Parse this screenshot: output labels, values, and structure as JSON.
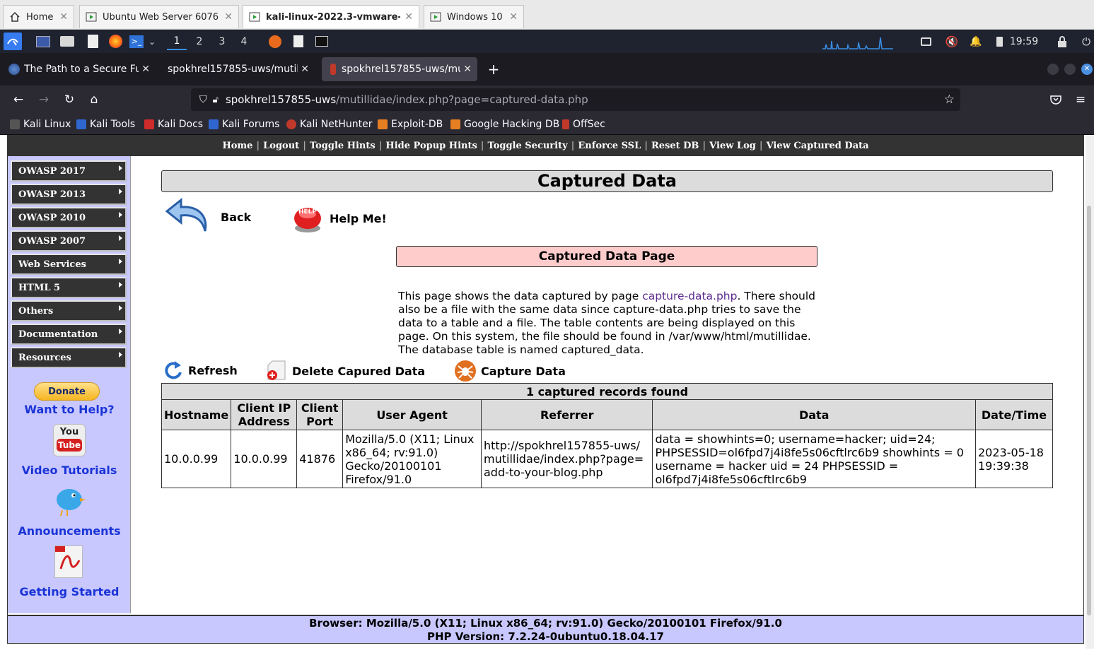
{
  "vm_tabs": [
    {
      "label": "Home",
      "active": false
    },
    {
      "label": "Ubuntu Web Server 6076",
      "active": false
    },
    {
      "label": "kali-linux-2022.3-vmware-a...",
      "active": true
    },
    {
      "label": "Windows 10",
      "active": false
    }
  ],
  "taskbar": {
    "workspaces": [
      "1",
      "2",
      "3",
      "4"
    ],
    "clock": "19:59"
  },
  "firefox_tabs": [
    {
      "label": "The Path to a Secure Futu",
      "active": false
    },
    {
      "label": "spokhrel157855-uws/mutillic",
      "active": false
    },
    {
      "label": "spokhrel157855-uws/mut",
      "active": true
    }
  ],
  "url": {
    "host": "spokhrel157855-uws",
    "path": "/mutillidae/index.php?page=captured-data.php"
  },
  "bookmarks": [
    {
      "label": "Kali Linux",
      "color": "#2b2a33"
    },
    {
      "label": "Kali Tools",
      "color": "#2f66d0"
    },
    {
      "label": "Kali Docs",
      "color": "#d02b2b"
    },
    {
      "label": "Kali Forums",
      "color": "#2f66d0"
    },
    {
      "label": "Kali NetHunter",
      "color": "#c0392b"
    },
    {
      "label": "Exploit-DB",
      "color": "#e67e22"
    },
    {
      "label": "Google Hacking DB",
      "color": "#e67e22"
    },
    {
      "label": "OffSec",
      "color": "#c0392b"
    }
  ],
  "top_menu": [
    "Home",
    "Logout",
    "Toggle Hints",
    "Hide Popup Hints",
    "Toggle Security",
    "Enforce SSL",
    "Reset DB",
    "View Log",
    "View Captured Data"
  ],
  "side_menu": [
    "OWASP 2017",
    "OWASP 2013",
    "OWASP 2010",
    "OWASP 2007",
    "Web Services",
    "HTML 5",
    "Others",
    "Documentation",
    "Resources"
  ],
  "side_links": {
    "donate": "Donate",
    "help": "Want to Help?",
    "youtube_line1": "You",
    "youtube_line2": "Tube",
    "video": "Video Tutorials",
    "announcements": "Announcements",
    "getting_started": "Getting Started"
  },
  "page": {
    "title": "Captured Data",
    "back": "Back",
    "help": "Help Me!",
    "help_icon_text": "HELP",
    "subtitle": "Captured Data Page",
    "desc_before": "This page shows the data captured by page ",
    "desc_link": "capture-data.php",
    "desc_after": ". There should also be a file with the same data since capture-data.php tries to save the data to a table and a file. The table contents are being displayed on this page. On this system, the file should be found in /var/www/html/mutillidae. The database table is named captured_data.",
    "refresh": "Refresh",
    "delete": "Delete Capured Data",
    "capture": "Capture Data"
  },
  "table": {
    "caption": "1 captured records found",
    "headers": [
      "Hostname",
      "Client IP Address",
      "Client Port",
      "User Agent",
      "Referrer",
      "Data",
      "Date/Time"
    ],
    "rows": [
      [
        "10.0.0.99",
        "10.0.0.99",
        "41876",
        "Mozilla/5.0 (X11; Linux x86_64; rv:91.0) Gecko/20100101 Firefox/91.0",
        "http://spokhrel157855-uws/mutillidae/index.php?page=add-to-your-blog.php",
        "data = showhints=0; username=hacker; uid=24; PHPSESSID=ol6fpd7j4i8fe5s06cftlrc6b9 showhints = 0 username = hacker uid = 24 PHPSESSID = ol6fpd7j4i8fe5s06cftlrc6b9",
        "2023-05-18 19:39:38"
      ]
    ]
  },
  "footer": {
    "browser": "Browser: Mozilla/5.0 (X11; Linux x86_64; rv:91.0) Gecko/20100101 Firefox/91.0",
    "php": "PHP Version: 7.2.24-0ubuntu0.18.04.17"
  }
}
